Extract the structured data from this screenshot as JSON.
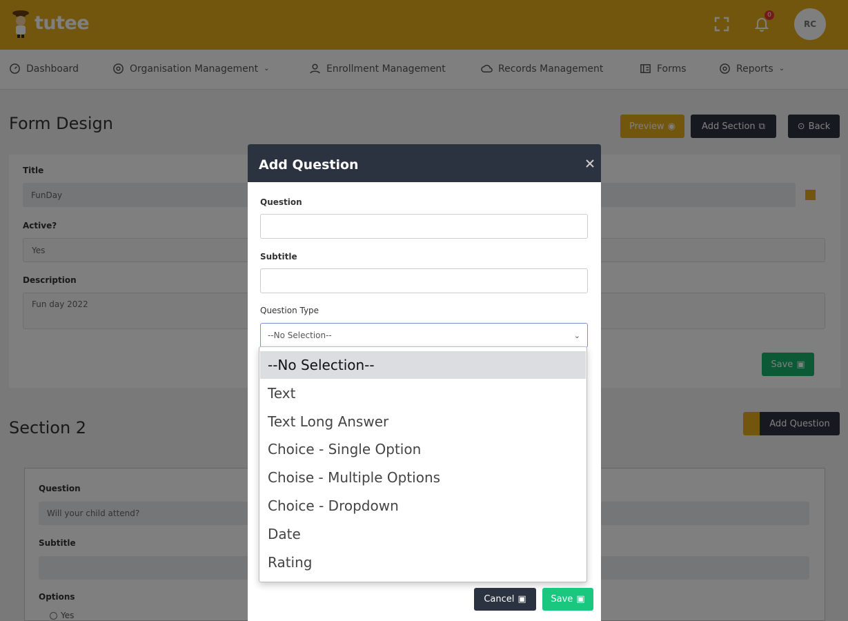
{
  "app": {
    "name": "tutee",
    "notification_count": "0",
    "avatar_initials": "RC"
  },
  "nav": {
    "items": [
      {
        "label": "Dashboard",
        "icon": "dashboard-icon"
      },
      {
        "label": "Organisation Management",
        "icon": "gear-icon"
      },
      {
        "label": "Enrollment Management",
        "icon": "user-icon"
      },
      {
        "label": "Records Management",
        "icon": "cloud-icon"
      },
      {
        "label": "Forms",
        "icon": "forms-icon"
      },
      {
        "label": "Reports",
        "icon": "reports-icon"
      }
    ]
  },
  "page": {
    "title": "Form Design",
    "buttons": {
      "preview": "Preview",
      "add_section": "Add Section",
      "back": "Back"
    }
  },
  "form": {
    "title_label": "Title",
    "title_value": "FunDay",
    "active_label": "Active?",
    "active_value": "Yes",
    "description_label": "Description",
    "description_value": "Fun day 2022",
    "save_label": "Save"
  },
  "section": {
    "title": "Section 2",
    "add_question_label": "Add Question",
    "question_label": "Question",
    "question_value": "Will your child attend?",
    "subtitle_label": "Subtitle",
    "options_label": "Options",
    "option_1": "Yes"
  },
  "modal": {
    "title": "Add Question",
    "question_label": "Question",
    "subtitle_label": "Subtitle",
    "question_type_label": "Question Type",
    "question_type_value": "--No Selection--",
    "options": [
      "--No Selection--",
      "Text",
      "Text Long Answer",
      "Choice - Single Option",
      "Choise - Multiple Options",
      "Choice - Dropdown",
      "Date",
      "Rating"
    ],
    "cancel_label": "Cancel",
    "save_label": "Save"
  },
  "colors": {
    "brand": "#e6ad1c",
    "dark": "#2c3340",
    "success": "#19b36d"
  }
}
